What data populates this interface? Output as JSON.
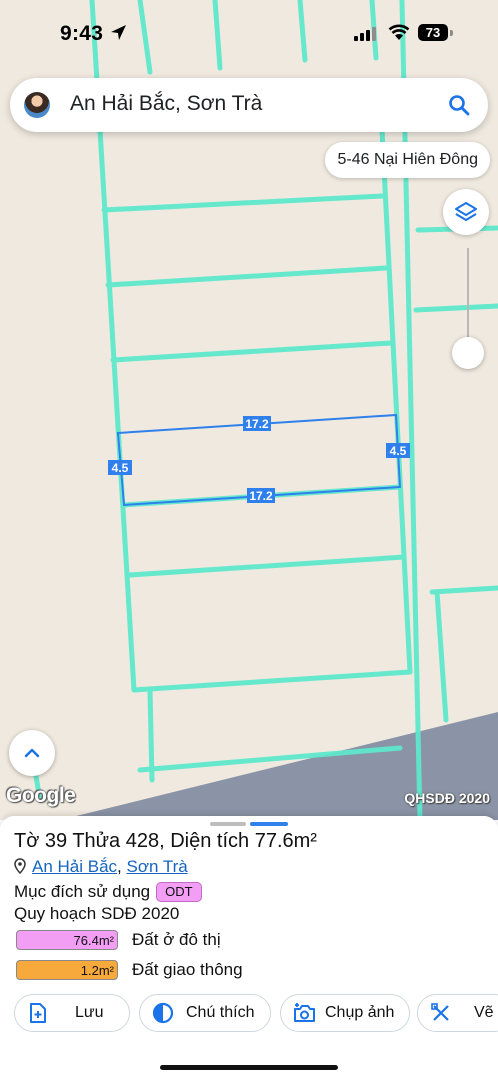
{
  "status_bar": {
    "time": "9:43",
    "battery": "73"
  },
  "search": {
    "query": "An Hải Bắc, Sơn Trà"
  },
  "street_chip": "5-46 Nại Hiên Đông",
  "map": {
    "parcel_edges": {
      "top": "17.2",
      "bottom": "17.2",
      "left": "4.5",
      "right": "4.5"
    },
    "parcel_color": "#2f80ed",
    "boundary_color": "#5ee8cc",
    "road_color": "#8a94a6",
    "attribution_google": "Google",
    "attribution_layer": "QHSDĐ 2020"
  },
  "sheet": {
    "title": "Tờ 39 Thửa 428, Diện tích 77.6m²",
    "address": {
      "ward": "An Hải Bắc",
      "separator": ", ",
      "district": "Sơn Trà"
    },
    "purpose_label": "Mục đích sử dụng",
    "purpose_code": "ODT",
    "plan_title": "Quy hoạch SDĐ 2020",
    "legend": [
      {
        "area": "76.4m²",
        "label": "Đất ở đô thị",
        "color": "#f29ef5"
      },
      {
        "area": "1.2m²",
        "label": "Đất giao thông",
        "color": "#f7a93b"
      }
    ],
    "actions": [
      {
        "label": "Lưu",
        "icon": "add-file-icon"
      },
      {
        "label": "Chú thích",
        "icon": "half-circle-icon"
      },
      {
        "label": "Chụp ảnh",
        "icon": "add-photo-icon"
      },
      {
        "label": "Vẽ",
        "icon": "draw-icon"
      }
    ]
  }
}
